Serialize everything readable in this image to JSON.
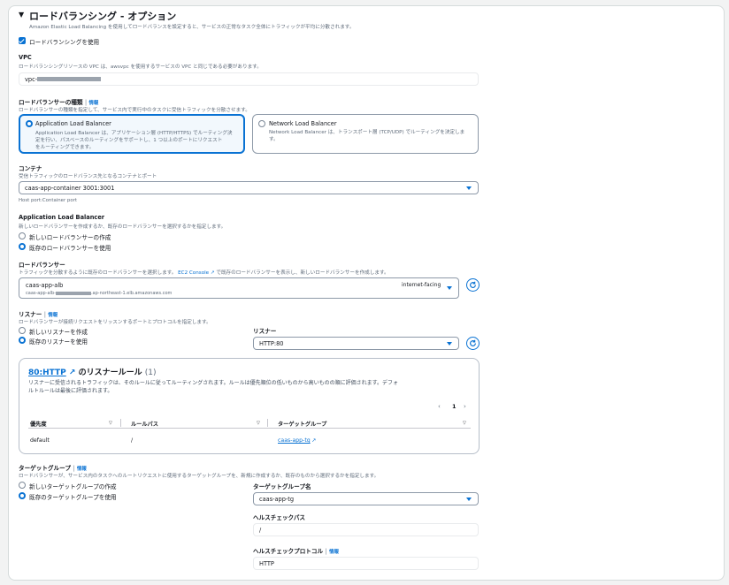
{
  "section": {
    "title": "ロードバランシング - オプション",
    "description": "Amazon Elastic Load Balancing を使用してロードバランスを設定すると、サービスの正常なタスク全体にトラフィックが平均に分散されます。",
    "use_lb_label": "ロードバランシングを使用"
  },
  "vpc": {
    "label": "VPC",
    "description": "ロードバランシングリソースの VPC は、awsvpc を使用するサービスの VPC と同じである必要があります。",
    "value": "vpc-"
  },
  "lb_type": {
    "label": "ロードバランサーの種類",
    "info": "情報",
    "description": "ロードバランサーの種類を指定して、サービス内で実行中のタスクに受信トラフィックを分散させます。",
    "alb_title": "Application Load Balancer",
    "alb_desc_1": "Application Load Balancer は、アプリケーション層 (HTTP/HTTPS) でルーティング決",
    "alb_desc_2": "定を行い、パスベースのルーティングをサポートし、1 つ以上のポートにリクエスト",
    "alb_desc_3": "をルーティングできます。",
    "nlb_title": "Network Load Balancer",
    "nlb_desc_1": "Network Load Balancer は、トランスポート層 (TCP/UDP) でルーティングを決定しま",
    "nlb_desc_2": "す。"
  },
  "container": {
    "label": "コンテナ",
    "description": "受信トラフィックのロードバランス先となるコンテナとポート",
    "value": "caas-app-container 3001:3001",
    "hint": "Host port:Container port"
  },
  "alb": {
    "label": "Application Load Balancer",
    "description": "新しいロードバランサーを作成するか、既存のロードバランサーを選択するかを指定します。",
    "option_new": "新しいロードバランサーの作成",
    "option_existing": "既存のロードバランサーを使用"
  },
  "load_balancer": {
    "label": "ロードバランサー",
    "description_1": "トラフィックを分散するように既存のロードバランサーを選択します。",
    "console_link": "EC2 Console",
    "description_2": "で既存のロードバランサーを表示し、新しいロードバランサーを作成します。",
    "name": "caas-app-alb",
    "dns_prefix": "caas-app-alb-",
    "dns_suffix": ".ap-northeast-1.elb.amazonaws.com",
    "scheme": "internet-facing"
  },
  "listener": {
    "label": "リスナー",
    "info": "情報",
    "description": "ロードバランサーが接続リクエストをリッスンするポートとプロトコルを指定します。",
    "option_new": "新しいリスナーを作成",
    "option_existing": "既存のリスナーを使用",
    "select_label": "リスナー",
    "select_value": "HTTP:80"
  },
  "rules": {
    "title_link": "80:HTTP",
    "title_rest": "のリスナールール",
    "count": "(1)",
    "description_1": "リスナーに受信されるトラフィックは、そのルールに従ってルーティングされます。ルールは優先順位の低いものから高いものの順に評価されます。デフォ",
    "description_2": "ルトルールは最後に評価されます。",
    "page": "1",
    "columns": [
      "優先度",
      "ルールパス",
      "ターゲットグループ"
    ],
    "rows": [
      {
        "priority": "default",
        "path": "/",
        "target": "caas-app-tg"
      }
    ]
  },
  "target_group": {
    "label": "ターゲットグループ",
    "info": "情報",
    "description": "ロードバランサーが、サービス内のタスクへのルートリクエストに使用するターゲットグループを、新規に作成するか、既存のものから選択するかを指定します。",
    "option_new": "新しいターゲットグループの作成",
    "option_existing": "既存のターゲットグループを使用",
    "name_label": "ターゲットグループ名",
    "name_value": "caas-app-tg",
    "health_path_label": "ヘルスチェックパス",
    "health_path_value": "/",
    "health_protocol_label": "ヘルスチェックプロトコル",
    "health_protocol_info": "情報",
    "health_protocol_value": "HTTP"
  },
  "colors": {
    "accent": "#0972d3",
    "border": "#8d99a8",
    "text_secondary": "#5f6b7a"
  }
}
